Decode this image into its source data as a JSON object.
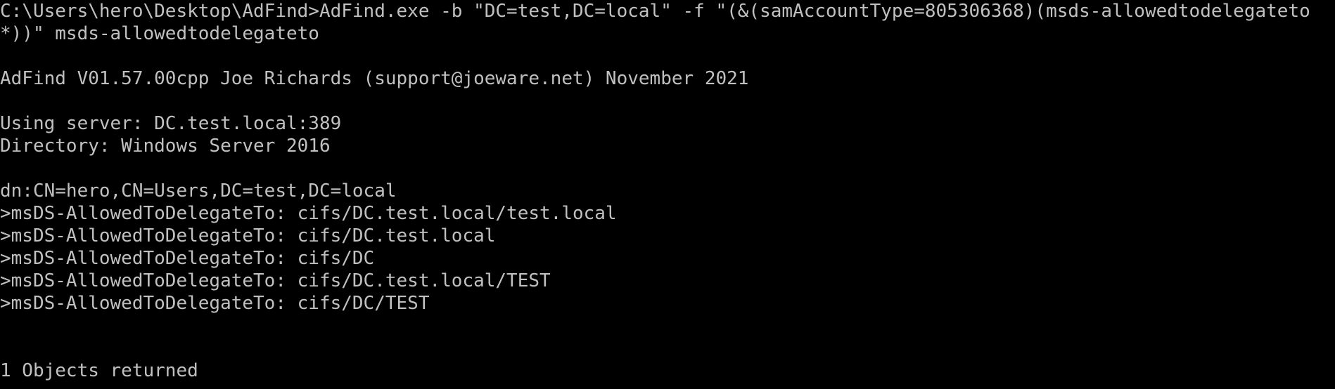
{
  "terminal": {
    "command_line_1": "C:\\Users\\hero\\Desktop\\AdFind>AdFind.exe -b \"DC=test,DC=local\" -f \"(&(samAccountType=805306368)(msds-allowedtodelegateto",
    "command_line_2": "*))\" msds-allowedtodelegateto",
    "banner": "AdFind V01.57.00cpp Joe Richards (support@joeware.net) November 2021",
    "server_line": "Using server: DC.test.local:389",
    "directory_line": "Directory: Windows Server 2016",
    "dn_line": "dn:CN=hero,CN=Users,DC=test,DC=local",
    "attribute_lines": [
      ">msDS-AllowedToDelegateTo: cifs/DC.test.local/test.local",
      ">msDS-AllowedToDelegateTo: cifs/DC.test.local",
      ">msDS-AllowedToDelegateTo: cifs/DC",
      ">msDS-AllowedToDelegateTo: cifs/DC.test.local/TEST",
      ">msDS-AllowedToDelegateTo: cifs/DC/TEST"
    ],
    "result_line": "1 Objects returned"
  },
  "colors": {
    "background": "#000000",
    "foreground": "#c0c0c0"
  }
}
